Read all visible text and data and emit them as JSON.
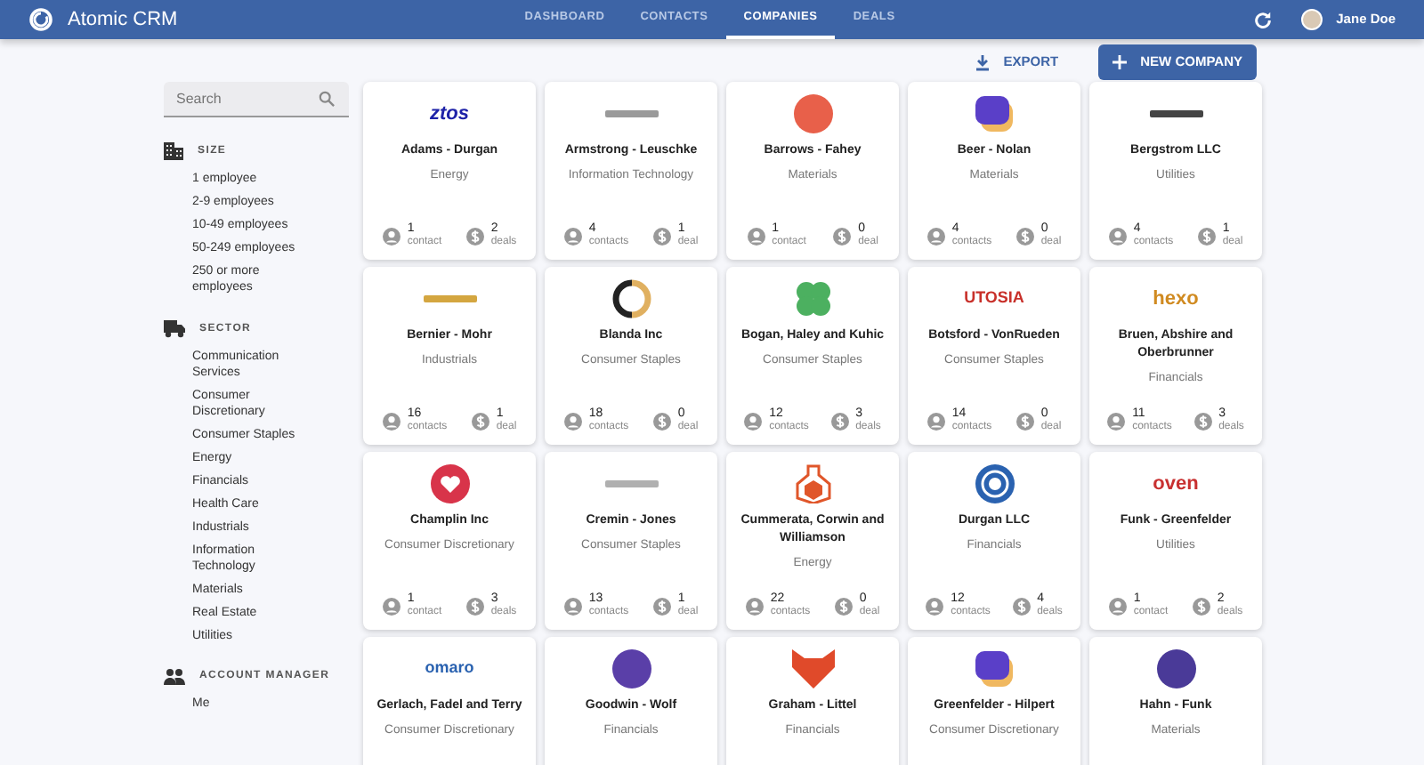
{
  "app": {
    "title": "Atomic CRM",
    "user": "Jane Doe"
  },
  "nav_tabs": [
    {
      "label": "DASHBOARD",
      "selected": false
    },
    {
      "label": "CONTACTS",
      "selected": false
    },
    {
      "label": "COMPANIES",
      "selected": true
    },
    {
      "label": "DEALS",
      "selected": false
    }
  ],
  "toolbar": {
    "export": "EXPORT",
    "new": "NEW COMPANY"
  },
  "sidebar": {
    "search": {
      "placeholder": "Search"
    },
    "sections": [
      {
        "kind": "size",
        "title": "SIZE",
        "items": [
          "1 employee",
          "2-9 employees",
          "10-49 employees",
          "50-249 employees",
          "250 or more employees"
        ]
      },
      {
        "kind": "sector",
        "title": "SECTOR",
        "items": [
          "Communication Services",
          "Consumer Discretionary",
          "Consumer Staples",
          "Energy",
          "Financials",
          "Health Care",
          "Industrials",
          "Information Technology",
          "Materials",
          "Real Estate",
          "Utilities"
        ]
      },
      {
        "kind": "manager",
        "title": "ACCOUNT MANAGER",
        "items": [
          "Me"
        ]
      }
    ]
  },
  "companies": [
    {
      "name": "Adams - Durgan",
      "sector": "Energy",
      "logo": {
        "kind": "wordmark",
        "text": "ztos",
        "color": "#1e22a8"
      },
      "contacts": "1",
      "contacts_label": "contact",
      "deals": "2",
      "deals_label": "deals"
    },
    {
      "name": "Armstrong - Leuschke",
      "sector": "Information Technology",
      "logo": {
        "kind": "mark",
        "color": "#9a9a9a"
      },
      "contacts": "4",
      "contacts_label": "contacts",
      "deals": "1",
      "deals_label": "deal"
    },
    {
      "name": "Barrows - Fahey",
      "sector": "Materials",
      "logo": {
        "kind": "disc",
        "color": "#e8604a"
      },
      "contacts": "1",
      "contacts_label": "contact",
      "deals": "0",
      "deals_label": "deal"
    },
    {
      "name": "Beer - Nolan",
      "sector": "Materials",
      "logo": {
        "kind": "tile",
        "color": "#5a3fc8"
      },
      "contacts": "4",
      "contacts_label": "contacts",
      "deals": "0",
      "deals_label": "deal"
    },
    {
      "name": "Bergstrom LLC",
      "sector": "Utilities",
      "logo": {
        "kind": "mark",
        "color": "#444444"
      },
      "contacts": "4",
      "contacts_label": "contacts",
      "deals": "1",
      "deals_label": "deal"
    },
    {
      "name": "Bernier - Mohr",
      "sector": "Industrials",
      "logo": {
        "kind": "mark",
        "color": "#d4a640"
      },
      "contacts": "16",
      "contacts_label": "contacts",
      "deals": "1",
      "deals_label": "deal"
    },
    {
      "name": "Blanda Inc",
      "sector": "Consumer Staples",
      "logo": {
        "kind": "ring",
        "color": "#222222"
      },
      "contacts": "18",
      "contacts_label": "contacts",
      "deals": "0",
      "deals_label": "deal"
    },
    {
      "name": "Bogan, Haley and Kuhic",
      "sector": "Consumer Staples",
      "logo": {
        "kind": "clover",
        "color": "#4cb060"
      },
      "contacts": "12",
      "contacts_label": "contacts",
      "deals": "3",
      "deals_label": "deals"
    },
    {
      "name": "Botsford - VonRueden",
      "sector": "Consumer Staples",
      "logo": {
        "kind": "wordmark",
        "text": "UTOSIA",
        "color": "#c8302a"
      },
      "contacts": "14",
      "contacts_label": "contacts",
      "deals": "0",
      "deals_label": "deal"
    },
    {
      "name": "Bruen, Abshire and Oberbrunner",
      "sector": "Financials",
      "logo": {
        "kind": "wordmark",
        "text": "hexo",
        "color": "#d08a20"
      },
      "contacts": "11",
      "contacts_label": "contacts",
      "deals": "3",
      "deals_label": "deals"
    },
    {
      "name": "Champlin Inc",
      "sector": "Consumer Discretionary",
      "logo": {
        "kind": "heart",
        "color": "#d8344a"
      },
      "contacts": "1",
      "contacts_label": "contact",
      "deals": "3",
      "deals_label": "deals"
    },
    {
      "name": "Cremin - Jones",
      "sector": "Consumer Staples",
      "logo": {
        "kind": "mark",
        "color": "#b0b0b0"
      },
      "contacts": "13",
      "contacts_label": "contacts",
      "deals": "1",
      "deals_label": "deal"
    },
    {
      "name": "Cummerata, Corwin and Williamson",
      "sector": "Energy",
      "logo": {
        "kind": "flask",
        "color": "#e0562a"
      },
      "contacts": "22",
      "contacts_label": "contacts",
      "deals": "0",
      "deals_label": "deal"
    },
    {
      "name": "Durgan LLC",
      "sector": "Financials",
      "logo": {
        "kind": "target",
        "color": "#2a62b0"
      },
      "contacts": "12",
      "contacts_label": "contacts",
      "deals": "4",
      "deals_label": "deals"
    },
    {
      "name": "Funk - Greenfelder",
      "sector": "Utilities",
      "logo": {
        "kind": "wordmark",
        "text": "oven",
        "color": "#c83030"
      },
      "contacts": "1",
      "contacts_label": "contact",
      "deals": "2",
      "deals_label": "deals"
    },
    {
      "name": "Gerlach, Fadel and Terry",
      "sector": "Consumer Discretionary",
      "logo": {
        "kind": "wordmark",
        "text": "omaro",
        "color": "#2a62b0"
      }
    },
    {
      "name": "Goodwin - Wolf",
      "sector": "Financials",
      "logo": {
        "kind": "disc",
        "color": "#5a3fa8"
      }
    },
    {
      "name": "Graham - Littel",
      "sector": "Financials",
      "logo": {
        "kind": "fox",
        "color": "#e04a2a"
      }
    },
    {
      "name": "Greenfelder - Hilpert",
      "sector": "Consumer Discretionary",
      "logo": {
        "kind": "tile",
        "color": "#5a3fc8"
      }
    },
    {
      "name": "Hahn - Funk",
      "sector": "Materials",
      "logo": {
        "kind": "disc",
        "color": "#4a3a98"
      }
    }
  ]
}
